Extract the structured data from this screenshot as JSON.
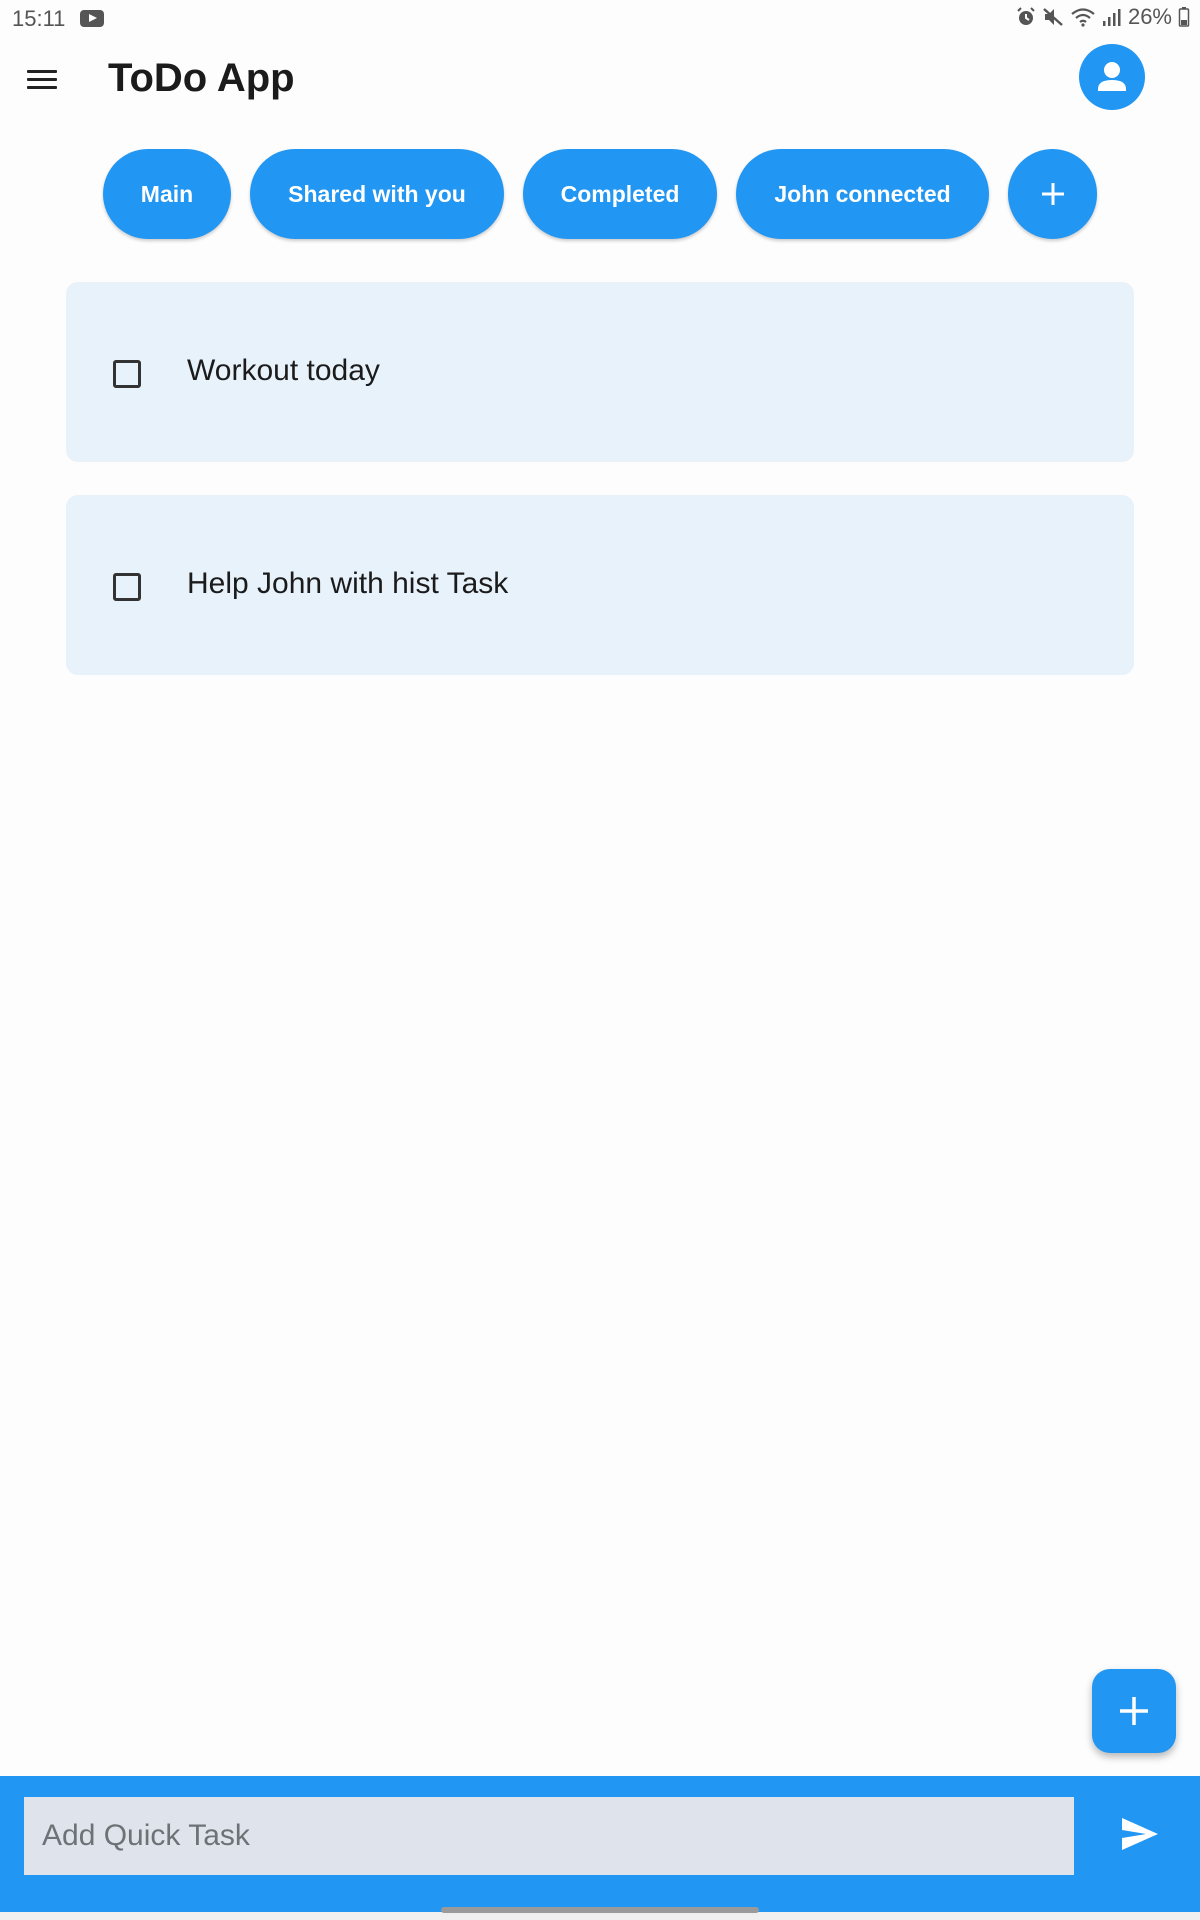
{
  "status_bar": {
    "time": "15:11",
    "battery": "26%",
    "icons": [
      "youtube-icon",
      "alarm-icon",
      "mute-icon",
      "wifi-icon",
      "signal-icon",
      "battery-icon"
    ]
  },
  "app_bar": {
    "title": "ToDo App",
    "menu_icon": "hamburger-menu-icon",
    "profile_icon": "person-icon"
  },
  "tabs": [
    {
      "label": "Main"
    },
    {
      "label": "Shared with you"
    },
    {
      "label": "Completed"
    },
    {
      "label": "John connected"
    }
  ],
  "add_tab_icon": "plus-icon",
  "tasks": [
    {
      "text": "Workout today",
      "checked": false
    },
    {
      "text": "Help John with hist Task",
      "checked": false
    }
  ],
  "fab_icon": "plus-icon",
  "quick_task": {
    "placeholder": "Add Quick Task",
    "value": "",
    "send_icon": "send-icon"
  },
  "colors": {
    "accent": "#2196f3",
    "card_background": "#e8f2fb",
    "input_background": "#dfe4ec"
  }
}
